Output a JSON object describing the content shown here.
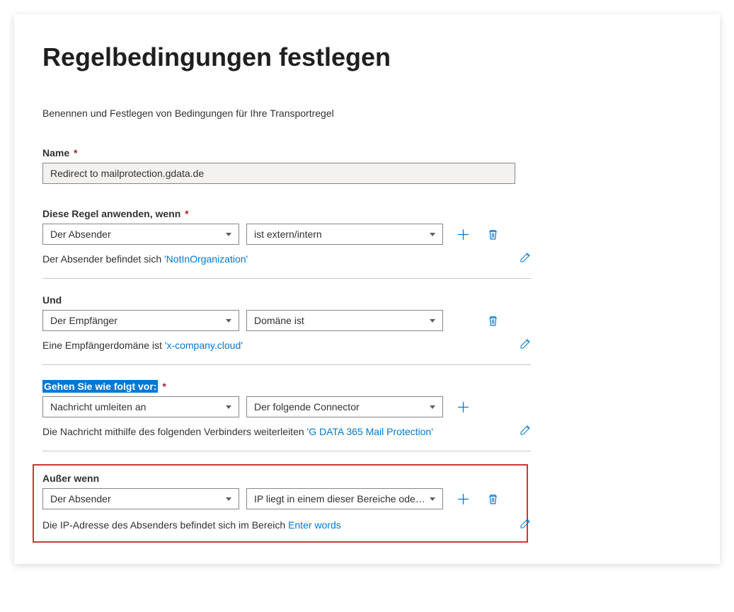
{
  "title": "Regelbedingungen festlegen",
  "subtitle": "Benennen und Festlegen von Bedingungen für Ihre Transportregel",
  "name": {
    "label": "Name",
    "value": "Redirect to mailprotection.gdata.de"
  },
  "apply_when": {
    "label": "Diese Regel anwenden, wenn",
    "select1": "Der Absender",
    "select2": "ist extern/intern",
    "summary_prefix": "Der Absender befindet sich ",
    "summary_link": "'NotInOrganization'"
  },
  "and": {
    "label": "Und",
    "select1": "Der Empfänger",
    "select2": "Domäne ist",
    "summary_prefix": "Eine Empfängerdomäne ist ",
    "summary_link": "'x-company.cloud'"
  },
  "do_action": {
    "label": "Gehen Sie wie folgt vor:",
    "select1": "Nachricht umleiten an",
    "select2": "Der folgende Connector",
    "summary_prefix": "Die Nachricht mithilfe des folgenden Verbinders weiterleiten ",
    "summary_link": "'G DATA 365 Mail Protection'"
  },
  "except": {
    "label": "Außer wenn",
    "select1": "Der Absender",
    "select2": "IP liegt in einem dieser Bereiche oder ...",
    "summary_prefix": "Die IP-Adresse des Absenders befindet sich im Bereich ",
    "summary_link": "Enter words"
  }
}
